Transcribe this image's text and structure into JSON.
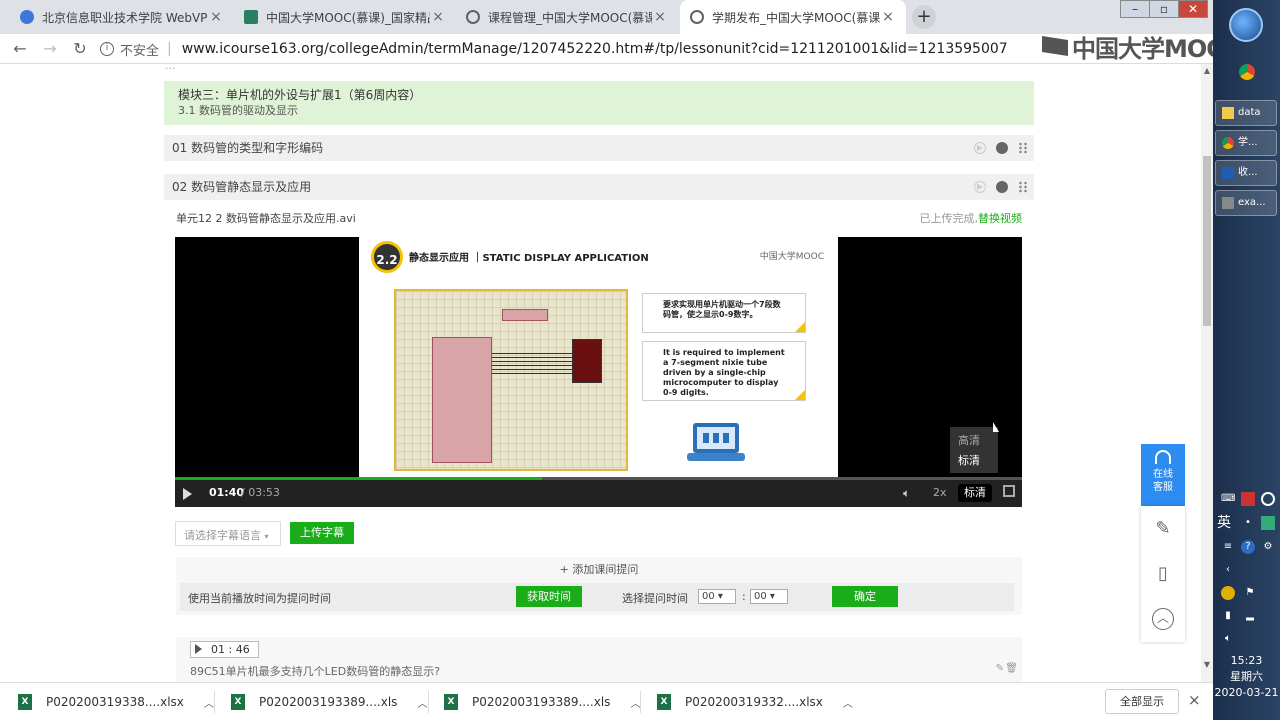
{
  "browser": {
    "tabs": [
      {
        "title": "北京信息职业技术学院 WebVPN",
        "active": false,
        "favicon_color": "#3c78d8"
      },
      {
        "title": "中国大学MOOC(慕课)_国家精品",
        "active": false,
        "favicon_color": "#2a7f62"
      },
      {
        "title": "课程管理_中国大学MOOC(慕课)",
        "active": false,
        "favicon_color": "#5f6368"
      },
      {
        "title": "学期发布_中国大学MOOC(慕课)",
        "active": true,
        "favicon_color": "#5f6368"
      }
    ],
    "close_glyph": "×",
    "new_tab_glyph": "+",
    "security_label": "不安全",
    "url": "www.icourse163.org/collegeAdmin/termManage/1207452220.htm#/tp/lessonunit?cid=1211201001&lid=1213595007",
    "brand_logo_text": "中国大学MOOC",
    "window_controls": {
      "minimize": "–",
      "restore": "▫",
      "close": "✕"
    }
  },
  "page": {
    "module": {
      "title": "模块三：单片机的外设与扩展1（第6周内容）",
      "subtitle": "3.1 数码管的驱动及显示"
    },
    "units": [
      {
        "label": "01 数码管的类型和字形编码"
      },
      {
        "label": "02 数码管静态显示及应用"
      }
    ],
    "video": {
      "filename": "单元12 2 数码管静态显示及应用.avi",
      "upload_status": "已上传完成,",
      "replace_link": "替换视频",
      "slide": {
        "badge": "2.2",
        "title": "静态显示应用 ｜STATIC DISPLAY APPLICATION",
        "logo": "中国大学MOOC",
        "text_cn": "要求实现用单片机驱动一个7段数码管，使之显示0-9数字。",
        "text_en": "It is required to implement a 7-segment nixie tube driven by a single-chip microcomputer to display 0-9 digits."
      },
      "current_time": "01:40",
      "separator": "/",
      "duration": "03:53",
      "progress_fraction": 0.433,
      "rate": "2x",
      "quality_current": "标清",
      "quality_options": [
        {
          "label": "高清",
          "selected": false
        },
        {
          "label": "标清",
          "selected": true
        }
      ]
    },
    "subtitles": {
      "placeholder": "请选择字幕语言",
      "upload_label": "上传字幕"
    },
    "quiz": {
      "add_label": "+ 添加课间提问",
      "use_current_label": "使用当前播放时间为提问时间",
      "get_time_button": "获取时间",
      "select_time_label": "选择提问时间",
      "minute": "00",
      "second": "00",
      "colon": ":",
      "confirm_button": "确定",
      "items": [
        {
          "time": "01 : 46",
          "question": "89C51单片机最多支持几个LED数码管的静态显示?"
        }
      ]
    },
    "truncated_breadcrumb": "..."
  },
  "widgets": {
    "online_help": "在线客服"
  },
  "downloads": {
    "files": [
      {
        "name": "P020200319338....xlsx"
      },
      {
        "name": "P0202003193389....xls"
      },
      {
        "name": "P0202003193389....xls"
      },
      {
        "name": "P020200319332....xlsx"
      }
    ],
    "show_all": "全部显示",
    "close_glyph": "×"
  },
  "taskbar": {
    "items": [
      {
        "label": "data",
        "color": "#f2c94c"
      },
      {
        "label": "学...",
        "color": "#e05a3a"
      },
      {
        "label": "收...",
        "color": "#1e5fb3"
      },
      {
        "label": "exa...",
        "color": "#888888"
      }
    ],
    "ime_label": "英",
    "time": "15:23",
    "weekday": "星期六",
    "date": "2020-03-21"
  }
}
